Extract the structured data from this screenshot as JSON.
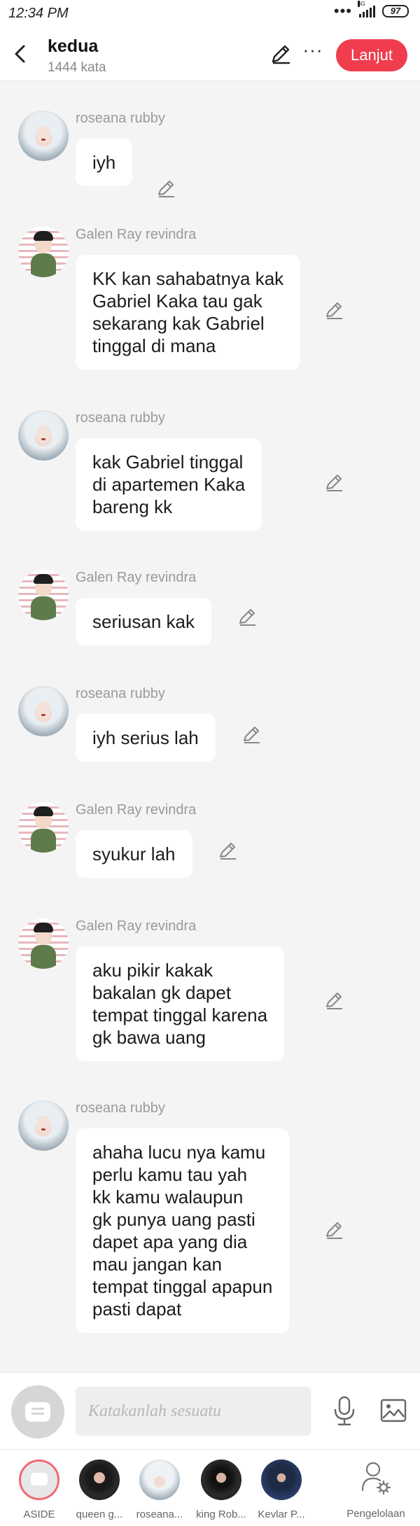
{
  "status": {
    "time": "12:34 PM",
    "battery": "97",
    "network": "4G"
  },
  "header": {
    "title": "kedua",
    "subtitle": "1444 kata",
    "next_label": "Lanjut"
  },
  "messages": [
    {
      "sender": "roseana rubby",
      "text": "iyh"
    },
    {
      "sender": "Galen Ray revindra",
      "text": "KK kan sahabatnya kak\nGabriel Kaka tau gak\nsekarang kak Gabriel\ntinggal di mana"
    },
    {
      "sender": "roseana rubby",
      "text": "kak Gabriel tinggal\ndi apartemen Kaka\nbareng kk"
    },
    {
      "sender": "Galen Ray revindra",
      "text": "seriusan kak"
    },
    {
      "sender": "roseana rubby",
      "text": "iyh serius lah"
    },
    {
      "sender": "Galen Ray revindra",
      "text": "syukur lah"
    },
    {
      "sender": "Galen Ray revindra",
      "text": "aku pikir kakak\nbakalan gk dapet\ntempat tinggal karena\ngk bawa uang"
    },
    {
      "sender": "roseana rubby",
      "text": "ahaha lucu nya kamu\nperlu kamu tau yah\nkk kamu walaupun\ngk punya uang pasti\ndapet apa yang dia\nmau jangan kan\ntempat tinggal apapun\npasti dapat"
    }
  ],
  "composer": {
    "placeholder": "Katakanlah sesuatu"
  },
  "characters": [
    {
      "name": "ASIDE",
      "icon": "chat-bubble-icon"
    },
    {
      "name": "queen g..."
    },
    {
      "name": "roseana..."
    },
    {
      "name": "king Rob..."
    },
    {
      "name": "Kevlar P..."
    }
  ],
  "manage_label": "Pengelolaan",
  "colors": {
    "accent": "#ef3d4d",
    "bubble": "#ffffff",
    "background": "#f4f4f4"
  }
}
